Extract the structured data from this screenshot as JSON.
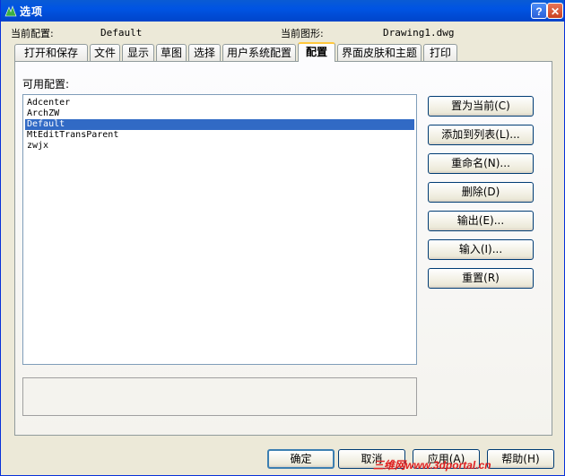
{
  "window": {
    "title": "选项",
    "help_glyph": "?",
    "close_glyph": "✕"
  },
  "info": {
    "current_profile_label": "当前配置:",
    "current_profile_value": "Default",
    "current_drawing_label": "当前图形:",
    "current_drawing_value": "Drawing1.dwg"
  },
  "tabs": [
    {
      "label": "打开和保存"
    },
    {
      "label": "文件"
    },
    {
      "label": "显示"
    },
    {
      "label": "草图"
    },
    {
      "label": "选择"
    },
    {
      "label": "用户系统配置"
    },
    {
      "label": "配置",
      "active": true
    },
    {
      "label": "界面皮肤和主题"
    },
    {
      "label": "打印"
    }
  ],
  "profiles": {
    "label": "可用配置:",
    "items": [
      "Adcenter",
      "ArchZW",
      "Default",
      "MtEditTransParent",
      "zwjx"
    ],
    "selected": "Default"
  },
  "side_buttons": {
    "set_current": "置为当前(C)",
    "add_to_list": "添加到列表(L)...",
    "rename": "重命名(N)...",
    "delete": "删除(D)",
    "export": "输出(E)...",
    "import": "输入(I)...",
    "reset": "重置(R)"
  },
  "bottom_buttons": {
    "ok": "确定",
    "cancel": "取消",
    "apply": "应用(A)",
    "help": "帮助(H)"
  },
  "watermark": "三维网www.3dportal.cn",
  "colors": {
    "titlebar": "#0054e3",
    "selection": "#316ac5",
    "watermark": "#e02020"
  }
}
